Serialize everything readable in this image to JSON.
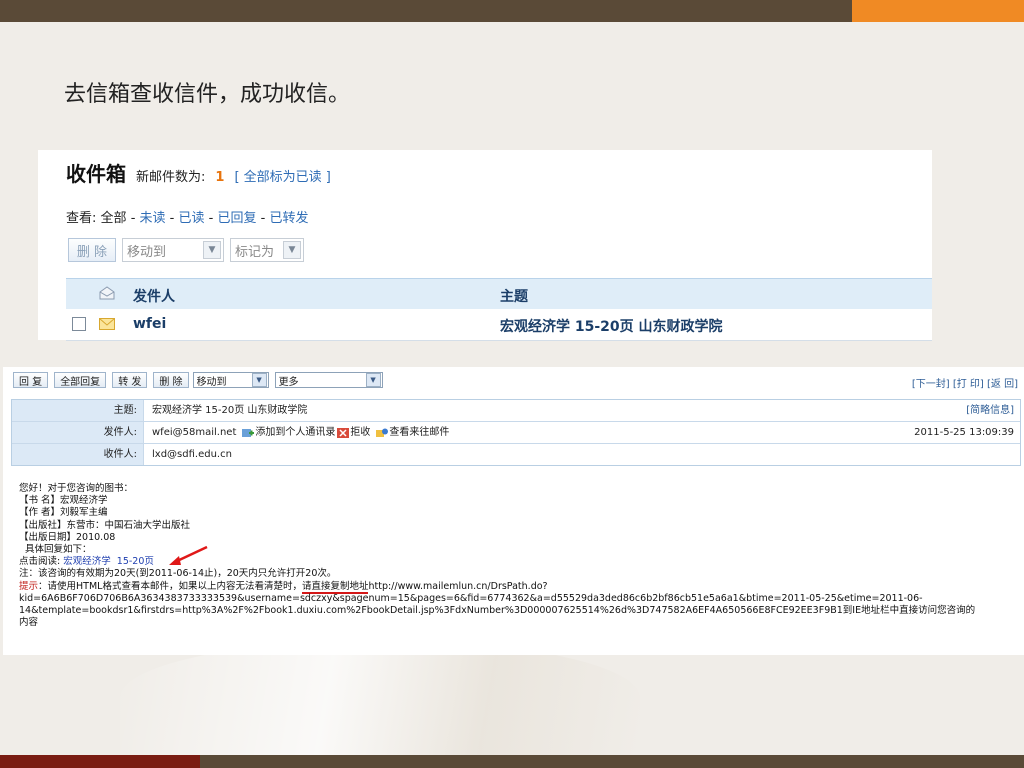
{
  "heading": "去信箱查收信件，成功收信。",
  "inbox": {
    "title": "收件箱",
    "new_count_label": "新邮件数为:",
    "new_count": "1",
    "mark_all_read": "[ 全部标为已读 ]",
    "view_label": "查看:",
    "view_all": "全部",
    "view_unread": "未读",
    "view_read": "已读",
    "view_replied": "已回复",
    "view_forwarded": "已转发",
    "delete_button": "删 除",
    "move_to": "移动到",
    "mark_as": "标记为",
    "col_sender": "发件人",
    "col_subject": "主题",
    "row_sender": "wfei",
    "row_subject": "宏观经济学  15-20页  山东财政学院"
  },
  "message": {
    "toolbar": {
      "reply": "回 复",
      "reply_all": "全部回复",
      "forward": "转 发",
      "delete": "删 除",
      "move_to": "移动到",
      "more": "更多"
    },
    "nav": "[下一封] [打 印] [返 回]",
    "subject_label": "主题:",
    "subject": "宏观经济学 15-20页 山东财政学院",
    "brief_info": "[简略信息]",
    "from_label": "发件人:",
    "from": "wfei@58mail.net",
    "add_contact": "添加到个人通讯录",
    "reject": "拒收",
    "view_history": "查看来往邮件",
    "date": "2011-5-25 13:09:39",
    "to_label": "收件人:",
    "to": "lxd@sdfi.edu.cn",
    "body": {
      "line1": "您好！对于您咨询的图书：",
      "line2": "【书 名】宏观经济学",
      "line3": "【作 者】刘毅军主编",
      "line4": "【出版社】东营市：中国石油大学出版社",
      "line5": "【出版日期】2010.08",
      "line6": "  具体回复如下：",
      "read_prefix": "点击阅读:",
      "read_link": "宏观经济学  15-20页",
      "note": "注：该咨询的有效期为20天(到2011-06-14止)，20天内只允许打开20次。",
      "tip_label": "提示",
      "tip_text": "：请使用HTML格式查看本邮件，如果以上内容无法看清楚时，",
      "tip_copy": "请直接复制地址",
      "url_line1": "http://www.mailemlun.cn/DrsPath.do?",
      "url_line2": "kid=6A6B6F706D706B6A3634383733333539&username=sdczxy&spagenum=15&pages=6&fid=6774362&a=d55529da3ded86c6b2bf86cb51e5a6a1&btime=2011-05-25&etime=2011-06-",
      "url_line3": "14&template=bookdsr1&firstdrs=http%3A%2F%2Fbook1.duxiu.com%2FbookDetail.jsp%3FdxNumber%3D000007625514%26d%3D747582A6EF4A650566E8FCE92EE3F9B1到IE地址栏中直接访问您咨询的",
      "url_line4": "内容"
    }
  }
}
